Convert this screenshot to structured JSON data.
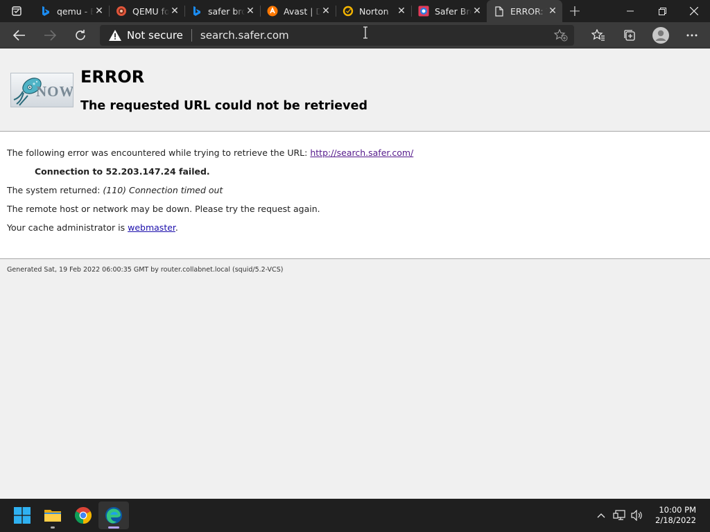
{
  "browser": {
    "tabs": [
      {
        "title": "qemu - Bing",
        "favicon": "bing-icon"
      },
      {
        "title": "QEMU for Windows",
        "favicon": "qemu-icon"
      },
      {
        "title": "safer browser - Bing",
        "favicon": "bing-icon"
      },
      {
        "title": "Avast | Download",
        "favicon": "avast-icon"
      },
      {
        "title": "Norton",
        "favicon": "norton-icon"
      },
      {
        "title": "Safer Browser",
        "favicon": "safer-icon"
      },
      {
        "title": "ERROR: The requested URL could not be retrieved",
        "favicon": "page-icon",
        "active": true
      }
    ],
    "address": {
      "security_label": "Not secure",
      "url": "search.safer.com"
    }
  },
  "page": {
    "heading": "ERROR",
    "subheading": "The requested URL could not be retrieved",
    "logo_text": "NOW",
    "line1_prefix": "The following error was encountered while trying to retrieve the URL: ",
    "line1_link": "http://search.safer.com/",
    "detail": "Connection to 52.203.147.24 failed.",
    "system_prefix": "The system returned: ",
    "system_value": "(110) Connection timed out",
    "remote_msg": "The remote host or network may be down. Please try the request again.",
    "admin_prefix": "Your cache administrator is ",
    "admin_link": "webmaster",
    "admin_suffix": ".",
    "footer": "Generated Sat, 19 Feb 2022 06:00:35 GMT by router.collabnet.local (squid/5.2-VCS)"
  },
  "taskbar": {
    "apps": [
      "start-icon",
      "file-explorer-icon",
      "chrome-icon",
      "edge-icon"
    ],
    "clock_time": "10:00 PM",
    "clock_date": "2/18/2022"
  }
}
